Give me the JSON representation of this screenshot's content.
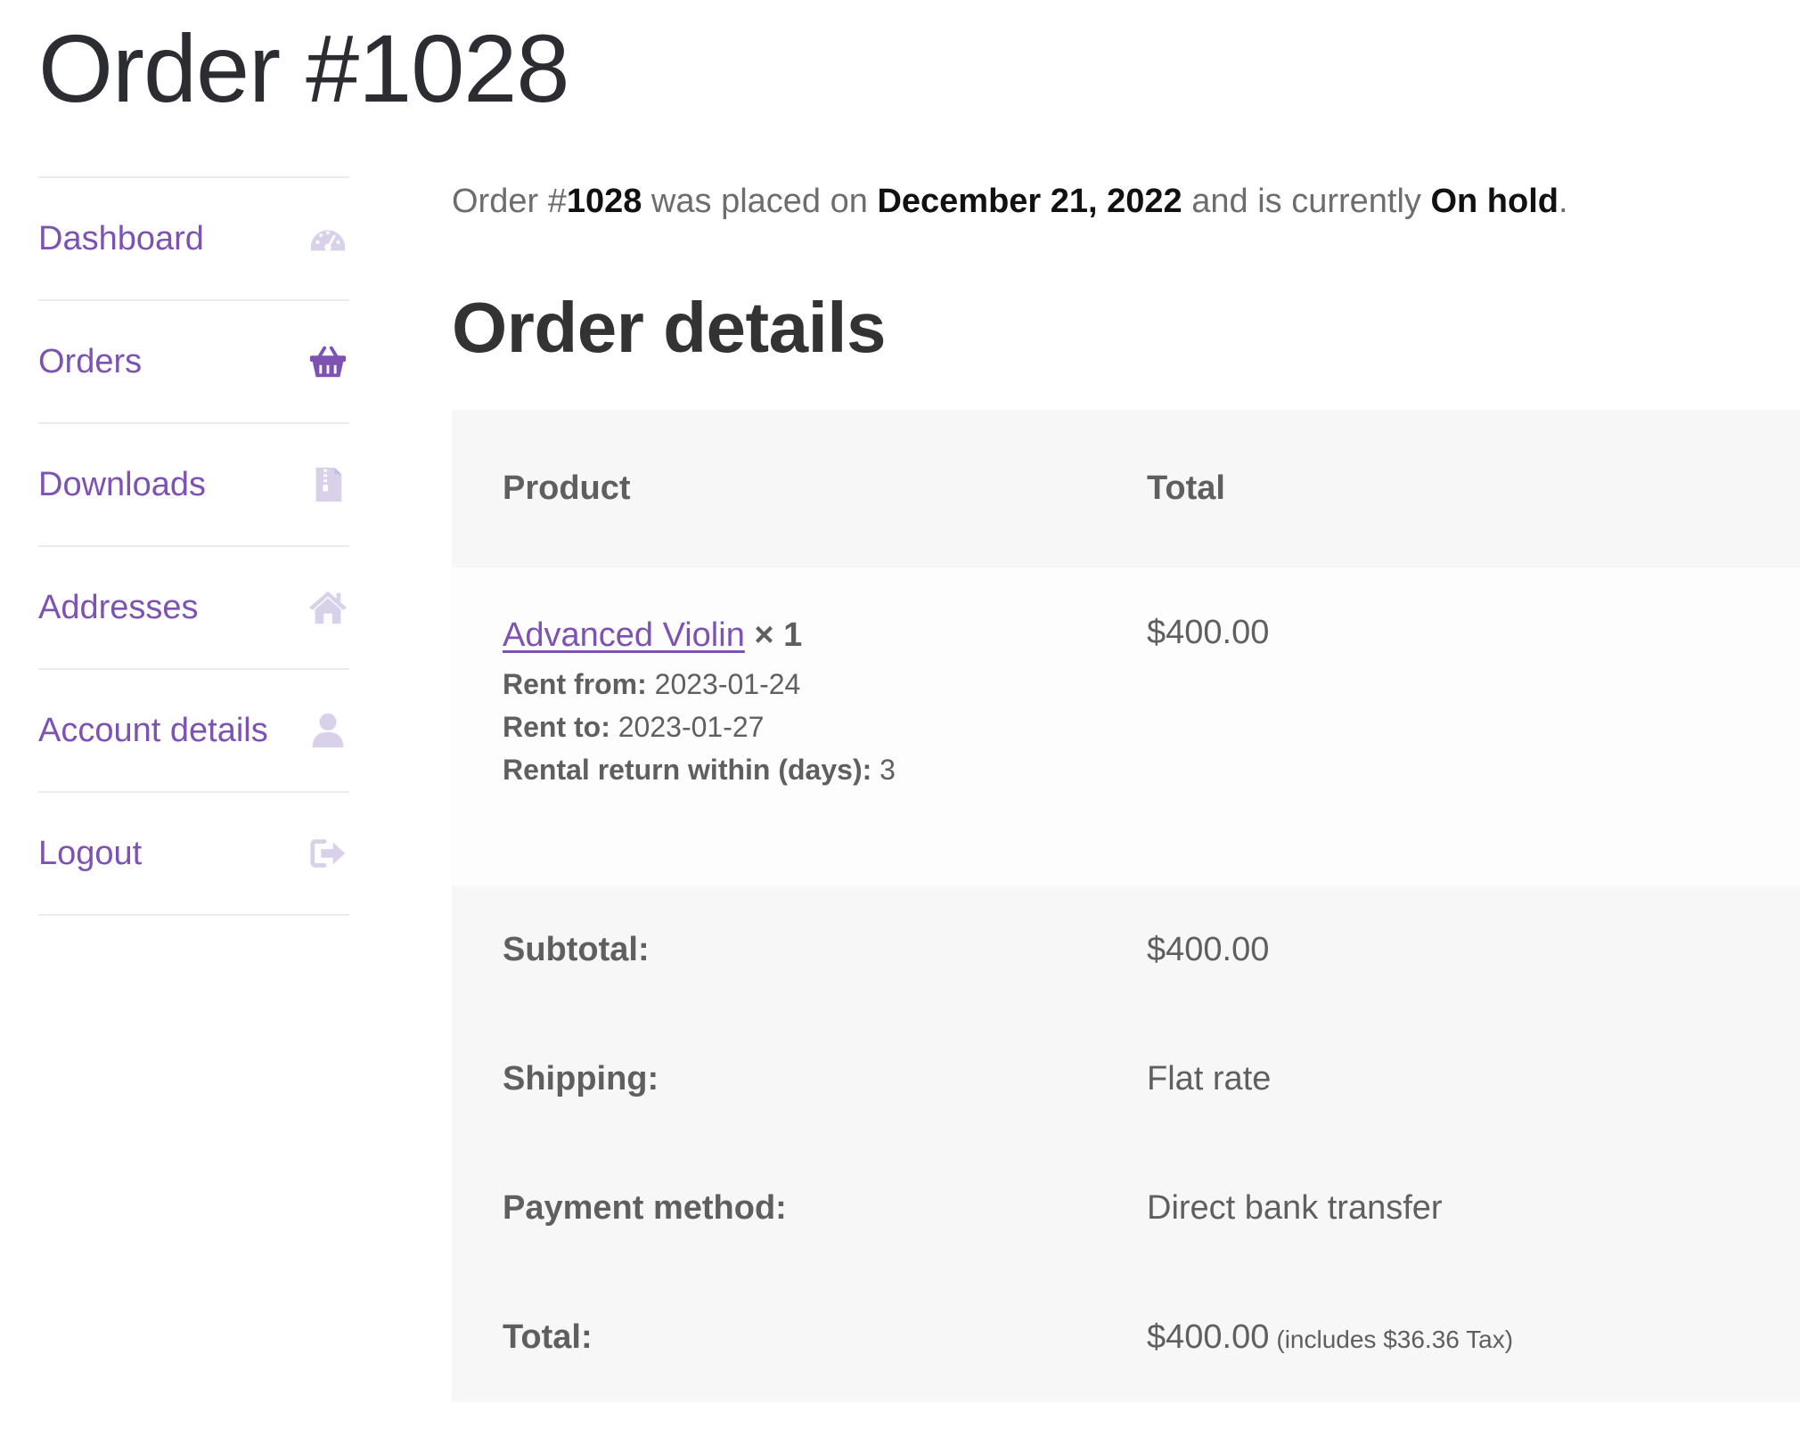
{
  "page": {
    "title": "Order #1028"
  },
  "sidebar": {
    "items": [
      {
        "label": "Dashboard",
        "icon": "dashboard-icon",
        "icon_color": "#d9d1e9"
      },
      {
        "label": "Orders",
        "icon": "basket-icon",
        "icon_color": "#7d52b3"
      },
      {
        "label": "Downloads",
        "icon": "file-archive-icon",
        "icon_color": "#d9d1e9"
      },
      {
        "label": "Addresses",
        "icon": "home-icon",
        "icon_color": "#d9d1e9"
      },
      {
        "label": "Account details",
        "icon": "user-icon",
        "icon_color": "#d9d1e9"
      },
      {
        "label": "Logout",
        "icon": "sign-out-icon",
        "icon_color": "#d9d1e9"
      }
    ]
  },
  "summary": {
    "prefix": "Order #",
    "order_number": "1028",
    "placed_text": " was placed on ",
    "date": "December 21, 2022",
    "status_text": " and is currently ",
    "status": "On hold",
    "suffix": "."
  },
  "details": {
    "title": "Order details",
    "columns": {
      "product": "Product",
      "total": "Total"
    },
    "item": {
      "name": "Advanced Violin",
      "qty": "× 1",
      "total": "$400.00",
      "meta": [
        {
          "key": "Rent from:",
          "value": "2023-01-24"
        },
        {
          "key": "Rent to:",
          "value": "2023-01-27"
        },
        {
          "key": "Rental return within (days):",
          "value": "3"
        }
      ]
    },
    "totals": {
      "subtotal_label": "Subtotal:",
      "subtotal_value": "$400.00",
      "shipping_label": "Shipping:",
      "shipping_value": "Flat rate",
      "payment_label": "Payment method:",
      "payment_value": "Direct bank transfer",
      "total_label": "Total:",
      "total_value": "$400.00",
      "tax_note": "(includes $36.36 Tax)"
    }
  },
  "colors": {
    "accent": "#7d52b3",
    "muted_icon": "#d9d1e9"
  }
}
